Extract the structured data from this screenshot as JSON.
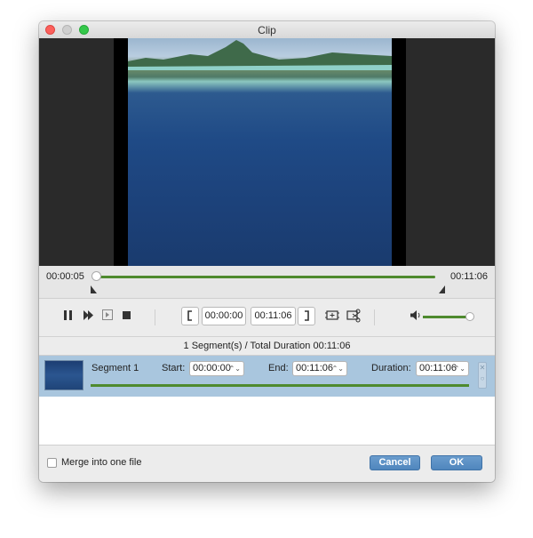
{
  "window": {
    "title": "Clip"
  },
  "timeline": {
    "current_time": "00:00:05",
    "total_time": "00:11:06"
  },
  "controls": {
    "start_time": "00:00:00",
    "end_time": "00:11:06",
    "volume_level": 0.9,
    "icons": [
      "pause-icon",
      "fast-forward-icon",
      "step-frame-icon",
      "stop-icon",
      "set-start-bracket-icon",
      "set-end-bracket-icon",
      "new-clip-icon",
      "split-clip-icon",
      "volume-icon"
    ]
  },
  "summary": {
    "text": "1 Segment(s) / Total Duration 00:11:06"
  },
  "segments": [
    {
      "name": "Segment 1",
      "start_label": "Start:",
      "start": "00:00:00",
      "end_label": "End:",
      "end": "00:11:06",
      "duration_label": "Duration:",
      "duration": "00:11:06"
    }
  ],
  "footer": {
    "merge_label": "Merge into one file",
    "merge_checked": false,
    "cancel_label": "Cancel",
    "ok_label": "OK"
  },
  "colors": {
    "accent_green": "#4e8a2e",
    "button_blue": "#5b8fc4",
    "selection_blue": "#a9c6de"
  }
}
